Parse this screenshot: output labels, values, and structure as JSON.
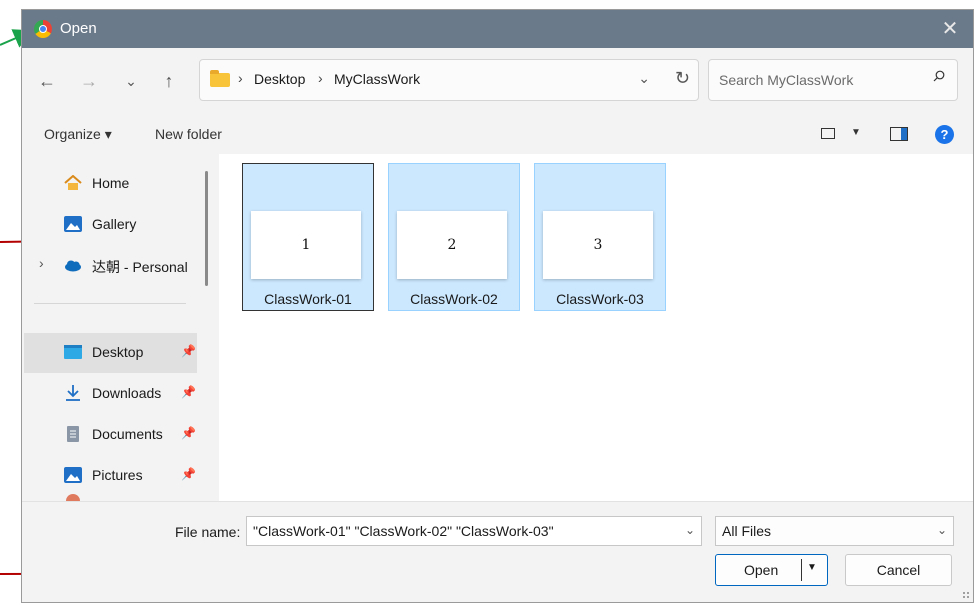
{
  "dialog": {
    "title": "Open",
    "close_glyph": "✕"
  },
  "nav": {
    "back_glyph": "←",
    "forward_glyph": "→",
    "recent_glyph": "⌄",
    "up_glyph": "↑",
    "breadcrumb": [
      "Desktop",
      "MyClassWork"
    ],
    "crumb_sep": "›",
    "dropdown_glyph": "⌄",
    "refresh_glyph": "↻",
    "search_placeholder": "Search MyClassWork"
  },
  "toolbar": {
    "organize_label": "Organize ▾",
    "new_folder_label": "New folder",
    "view_caret": "▼",
    "help_glyph": "?"
  },
  "sidebar": {
    "items": [
      {
        "label": "Home",
        "icon": "home-icon"
      },
      {
        "label": "Gallery",
        "icon": "gallery-icon"
      },
      {
        "label": "达朝 - Personal",
        "icon": "onedrive-icon",
        "expand": "›"
      },
      {
        "label": "Desktop",
        "icon": "desktop-icon",
        "pinned": true
      },
      {
        "label": "Downloads",
        "icon": "download-icon",
        "pinned": true
      },
      {
        "label": "Documents",
        "icon": "document-icon",
        "pinned": true
      },
      {
        "label": "Pictures",
        "icon": "pictures-icon",
        "pinned": true
      }
    ],
    "pin_glyph": "📌"
  },
  "files": [
    {
      "name": "ClassWork-01",
      "thumb_text": "1"
    },
    {
      "name": "ClassWork-02",
      "thumb_text": "2"
    },
    {
      "name": "ClassWork-03",
      "thumb_text": "3"
    }
  ],
  "footer": {
    "file_name_label": "File name:",
    "file_name_value": "\"ClassWork-01\" \"ClassWork-02\" \"ClassWork-03\"",
    "dropdown_glyph": "⌄",
    "file_type": "All Files",
    "open_label": "Open",
    "open_caret": "▼",
    "cancel_label": "Cancel"
  },
  "colors": {
    "titlebar": "#6b7a8b",
    "selection_fill": "#cce8ff",
    "selection_border": "#99d1ff",
    "annotation_red": "#b30000",
    "annotation_green": "#1aa34a"
  }
}
